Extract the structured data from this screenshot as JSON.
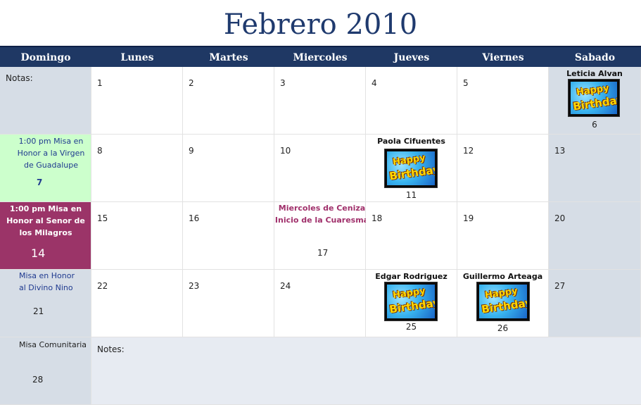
{
  "title": "Febrero 2010",
  "days": [
    "Domingo",
    "Lunes",
    "Martes",
    "Miercoles",
    "Jueves",
    "Viernes",
    "Sabado"
  ],
  "notas_label": "Notas:",
  "notes_label": "Notes:",
  "dates": {
    "d1": "1",
    "d2": "2",
    "d3": "3",
    "d4": "4",
    "d5": "5",
    "d6": "6",
    "d7": "7",
    "d8": "8",
    "d9": "9",
    "d10": "10",
    "d11": "11",
    "d12": "12",
    "d13": "13",
    "d14": "14",
    "d15": "15",
    "d16": "16",
    "d17": "17",
    "d18": "18",
    "d19": "19",
    "d20": "20",
    "d21": "21",
    "d22": "22",
    "d23": "23",
    "d24": "24",
    "d25": "25",
    "d26": "26",
    "d27": "27",
    "d28": "28"
  },
  "birthdays": {
    "d6": "Leticia Alvan",
    "d11": "Paola Cifuentes",
    "d25": "Edgar Rodriguez",
    "d26": "Guillermo Arteaga"
  },
  "birthday_image_text": {
    "line1": "Happy",
    "line2": "Birthday!"
  },
  "events": {
    "d7": "1:00 pm Misa en Honor a la Virgen de Guadalupe",
    "d14": "1:00 pm Misa en Honor al Senor de los Milagros",
    "d17_line1": "Miercoles de Ceniza",
    "d17_line2": "Inicio de la Cuaresma",
    "d21": "Misa en Honor al Divino Nino",
    "d28": "Misa Comunitaria"
  },
  "colors": {
    "header": "#1f3864",
    "title": "#1f3a6e",
    "weekend": "#d6dde6",
    "green_event": "#ccffcc",
    "maroon_event": "#9b3468",
    "event_text": "#1f3a8f"
  }
}
